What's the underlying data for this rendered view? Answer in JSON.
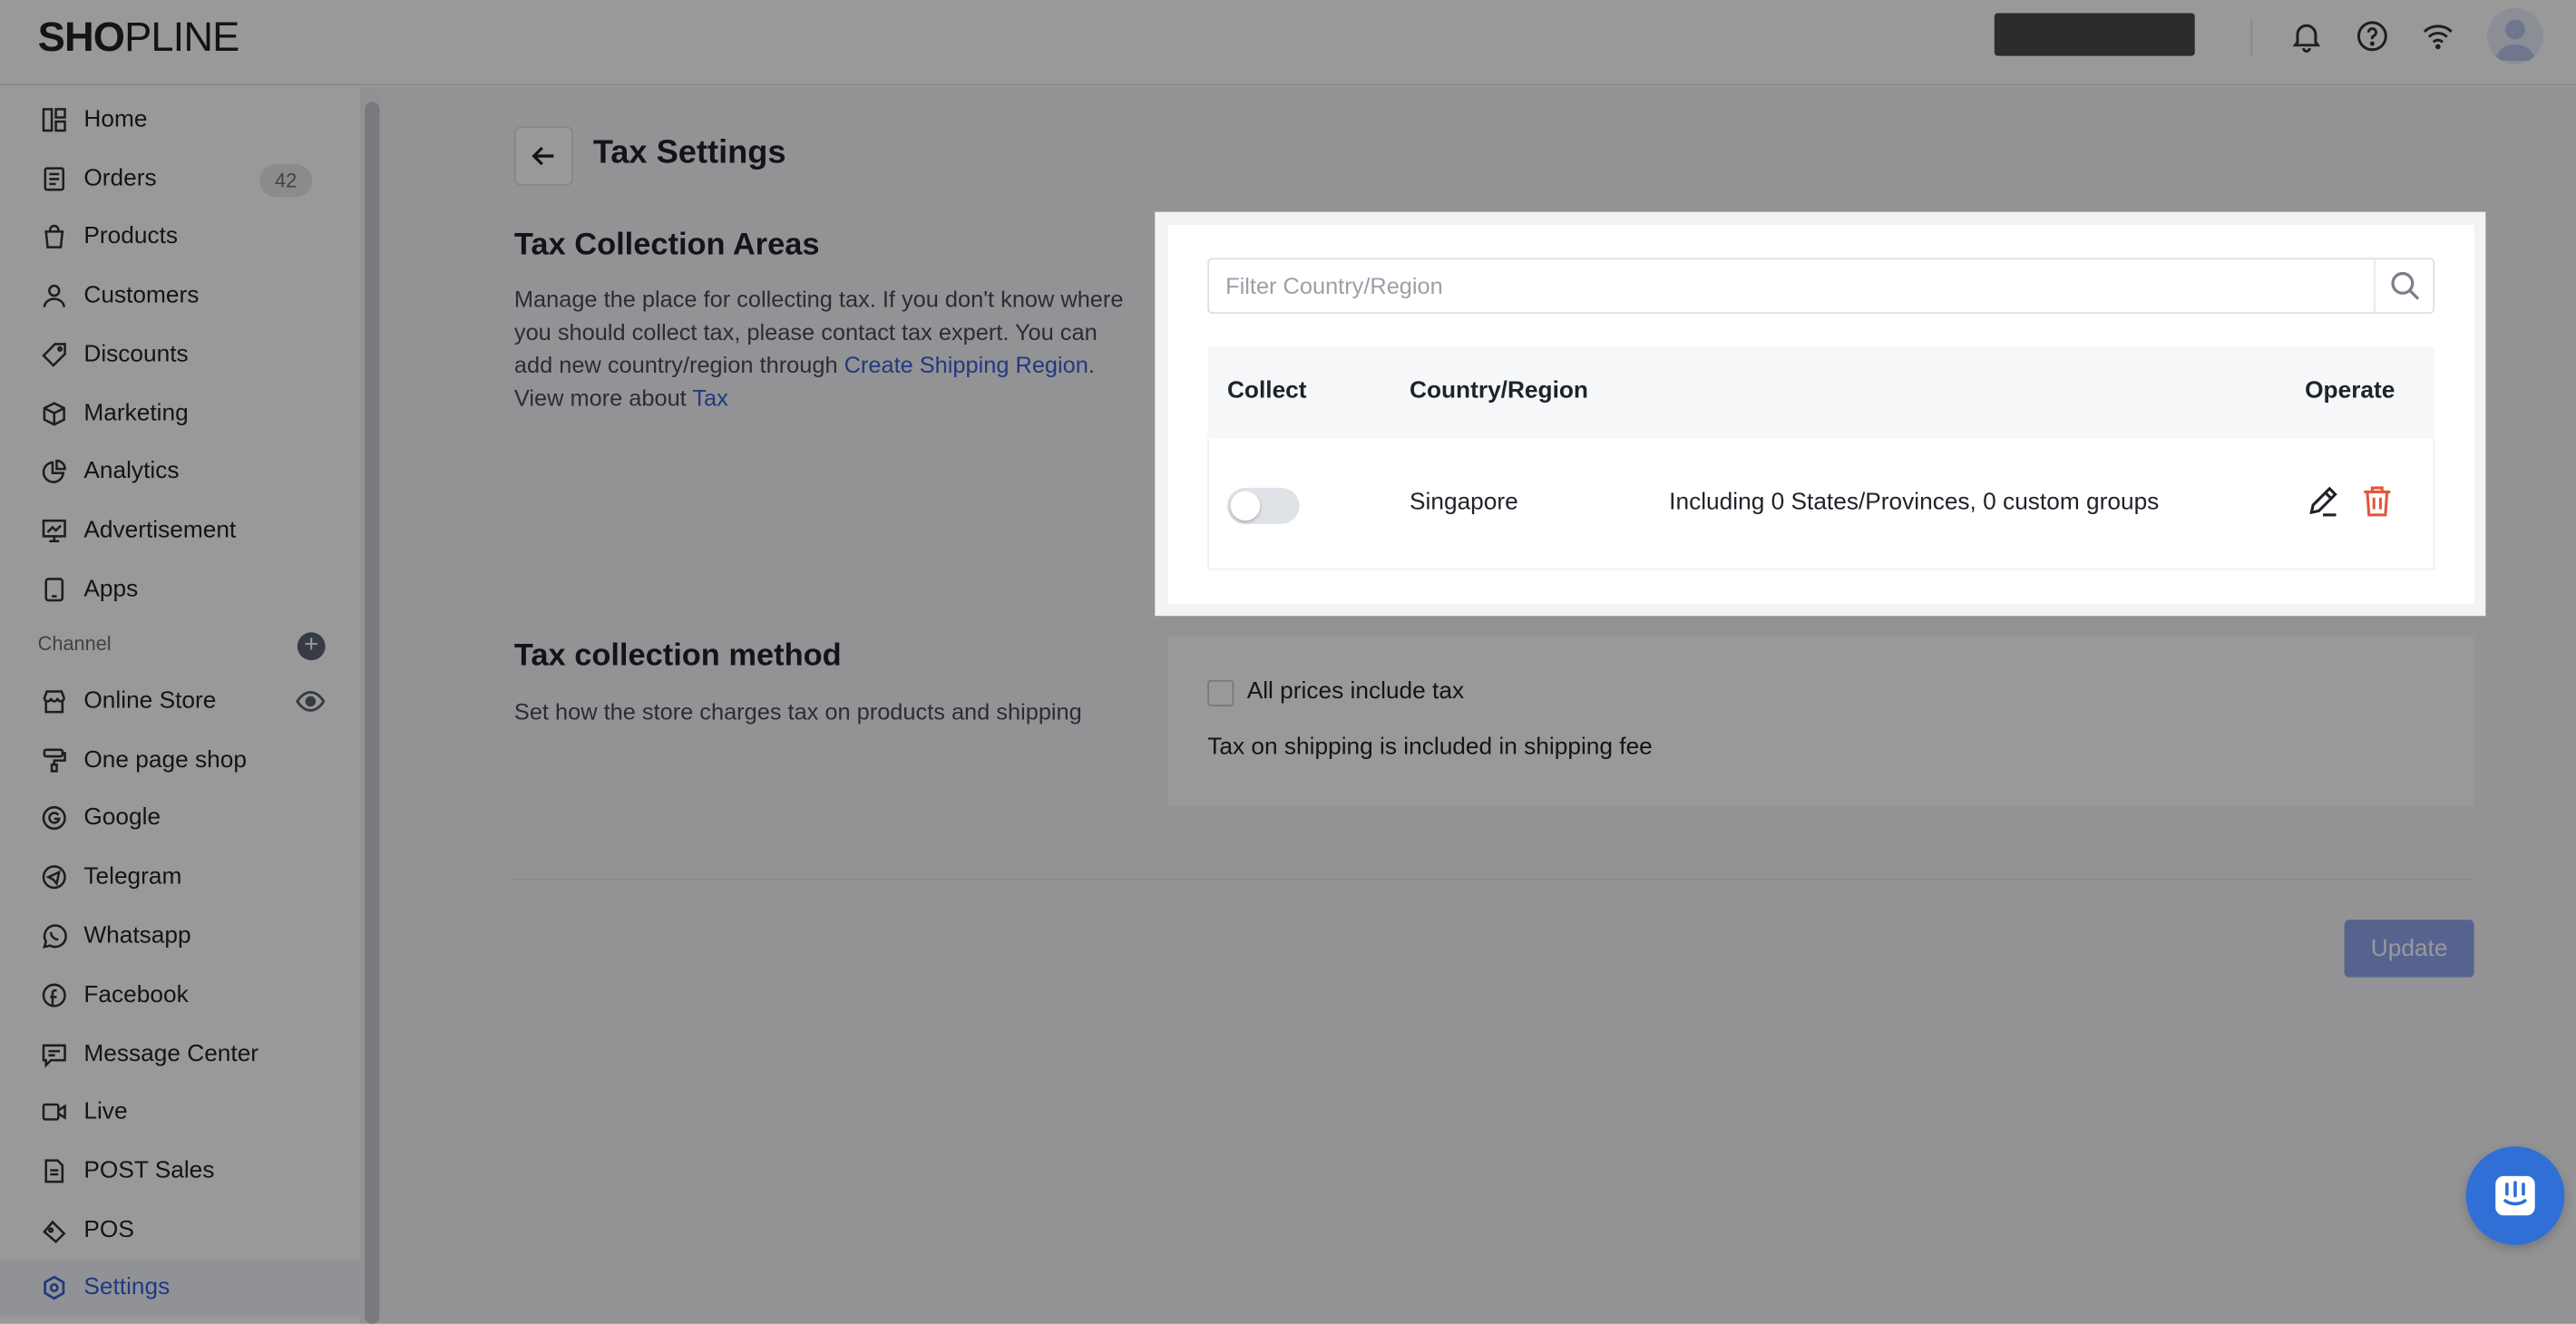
{
  "header": {
    "logo_bold": "SH",
    "logo_o": "O",
    "logo_rest": "PLINE",
    "icons": [
      "bell-icon",
      "help-icon",
      "wifi-icon",
      "avatar"
    ]
  },
  "sidebar": {
    "items": [
      {
        "label": "Home",
        "icon": "home-icon"
      },
      {
        "label": "Orders",
        "icon": "orders-icon",
        "badge": "42"
      },
      {
        "label": "Products",
        "icon": "bag-icon"
      },
      {
        "label": "Customers",
        "icon": "user-icon"
      },
      {
        "label": "Discounts",
        "icon": "tag-icon"
      },
      {
        "label": "Marketing",
        "icon": "cube-icon"
      },
      {
        "label": "Analytics",
        "icon": "pie-icon"
      },
      {
        "label": "Advertisement",
        "icon": "ad-icon"
      },
      {
        "label": "Apps",
        "icon": "apps-icon"
      }
    ],
    "channel_label": "Channel",
    "channels": [
      {
        "label": "Online Store",
        "icon": "store-icon"
      },
      {
        "label": "One page shop",
        "icon": "brush-icon"
      },
      {
        "label": "Google",
        "icon": "google-icon"
      },
      {
        "label": "Telegram",
        "icon": "telegram-icon"
      },
      {
        "label": "Whatsapp",
        "icon": "whatsapp-icon"
      },
      {
        "label": "Facebook",
        "icon": "facebook-icon"
      },
      {
        "label": "Message Center",
        "icon": "message-icon"
      },
      {
        "label": "Live",
        "icon": "video-icon"
      },
      {
        "label": "POST Sales",
        "icon": "doc-icon"
      },
      {
        "label": "POS",
        "icon": "pos-icon"
      }
    ],
    "settings_label": "Settings"
  },
  "page": {
    "title": "Tax Settings",
    "areas": {
      "title": "Tax Collection Areas",
      "desc_1": "Manage the place for collecting tax. If you don't know where you should collect tax, please contact tax expert. You can add new country/region through ",
      "link_shipping": "Create Shipping Region",
      "desc_2": ". View more about ",
      "link_tax": "Tax",
      "filter_placeholder": "Filter Country/Region",
      "columns": {
        "collect": "Collect",
        "country": "Country/Region",
        "operate": "Operate"
      },
      "rows": [
        {
          "country": "Singapore",
          "detail": "Including 0 States/Provinces, 0 custom groups",
          "collect": false
        }
      ]
    },
    "method": {
      "title": "Tax collection method",
      "desc": "Set how the store charges tax on products and shipping",
      "checkbox_label": "All prices include tax",
      "checked": false,
      "shipping_note": "Tax on shipping is included in shipping fee"
    },
    "update_label": "Update"
  },
  "colors": {
    "accent": "#3a5fd5",
    "danger": "#e5553e",
    "update_disabled": "#8fa6ee"
  }
}
